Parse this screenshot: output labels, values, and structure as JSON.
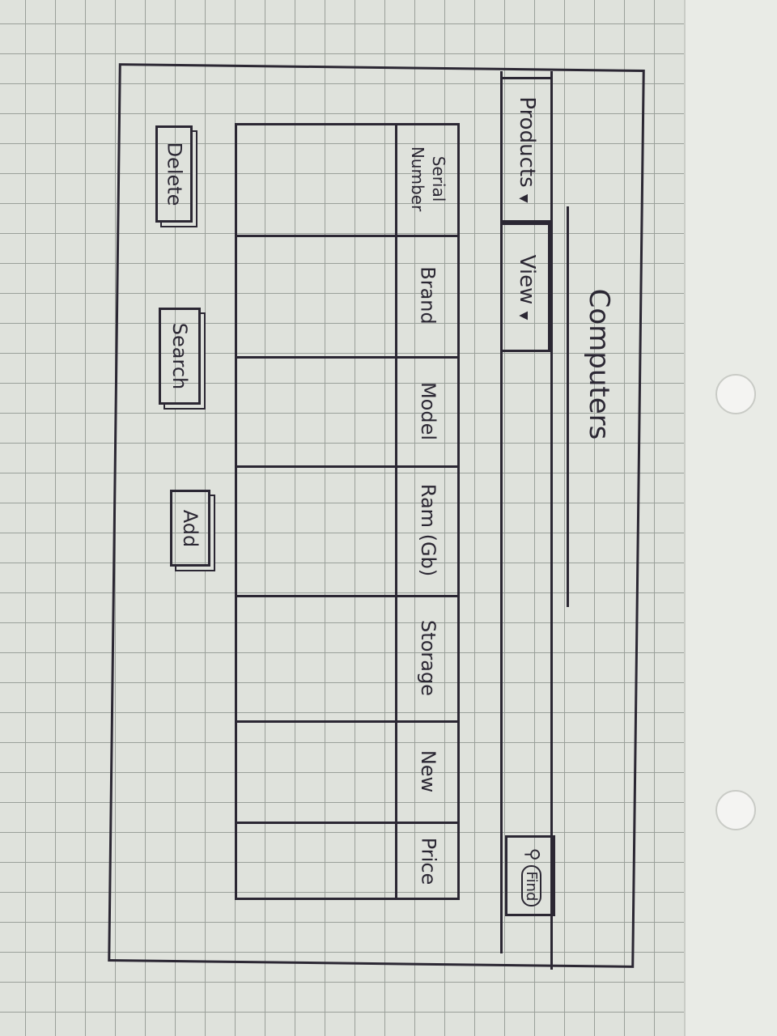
{
  "window": {
    "title": "Computers"
  },
  "menubar": {
    "menus": [
      {
        "label": "Products",
        "icon": "dropdown-arrow-icon"
      },
      {
        "label": "View",
        "icon": "dropdown-arrow-icon"
      }
    ],
    "search_icon": "magnifier-icon",
    "search_label": "Find"
  },
  "table": {
    "columns": [
      "Serial Number",
      "Brand",
      "Model",
      "Ram (Gb)",
      "Storage",
      "New",
      "Price"
    ],
    "rows": []
  },
  "actions": {
    "delete_label": "Delete",
    "search_label": "Search",
    "add_label": "Add"
  }
}
